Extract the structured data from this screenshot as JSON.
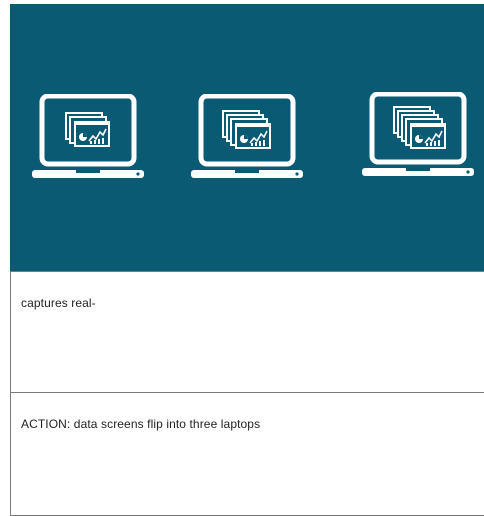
{
  "storyboard": {
    "image_panel": {
      "background_color": "#0b5a73",
      "icons": [
        "laptop-with-chart-screens-icon",
        "laptop-with-chart-screens-icon",
        "laptop-with-chart-screens-icon"
      ]
    },
    "narration_text": "captures real-",
    "action_text": "ACTION: data screens flip into three laptops"
  }
}
